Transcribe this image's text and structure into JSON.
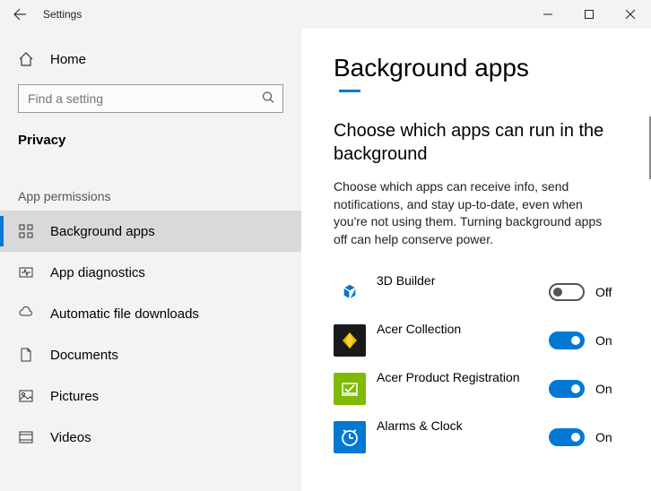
{
  "titlebar": {
    "title": "Settings"
  },
  "sidebar": {
    "home": "Home",
    "search_placeholder": "Find a setting",
    "category": "Privacy",
    "section": "App permissions",
    "items": [
      {
        "label": "Background apps",
        "selected": true
      },
      {
        "label": "App diagnostics",
        "selected": false
      },
      {
        "label": "Automatic file downloads",
        "selected": false
      },
      {
        "label": "Documents",
        "selected": false
      },
      {
        "label": "Pictures",
        "selected": false
      },
      {
        "label": "Videos",
        "selected": false
      }
    ]
  },
  "page": {
    "title": "Background apps",
    "section_heading": "Choose which apps can run in the background",
    "section_desc": "Choose which apps can receive info, send notifications, and stay up-to-date, even when you're not using them. Turning background apps off can help conserve power."
  },
  "apps": [
    {
      "name": "3D Builder",
      "state": "off",
      "state_label": "Off",
      "icon_bg": "#0078d4"
    },
    {
      "name": "Acer Collection",
      "state": "on",
      "state_label": "On",
      "icon_bg": "#1a1a1a"
    },
    {
      "name": "Acer Product Registration",
      "state": "on",
      "state_label": "On",
      "icon_bg": "#7fba00"
    },
    {
      "name": "Alarms & Clock",
      "state": "on",
      "state_label": "On",
      "icon_bg": "#0078d4"
    }
  ]
}
